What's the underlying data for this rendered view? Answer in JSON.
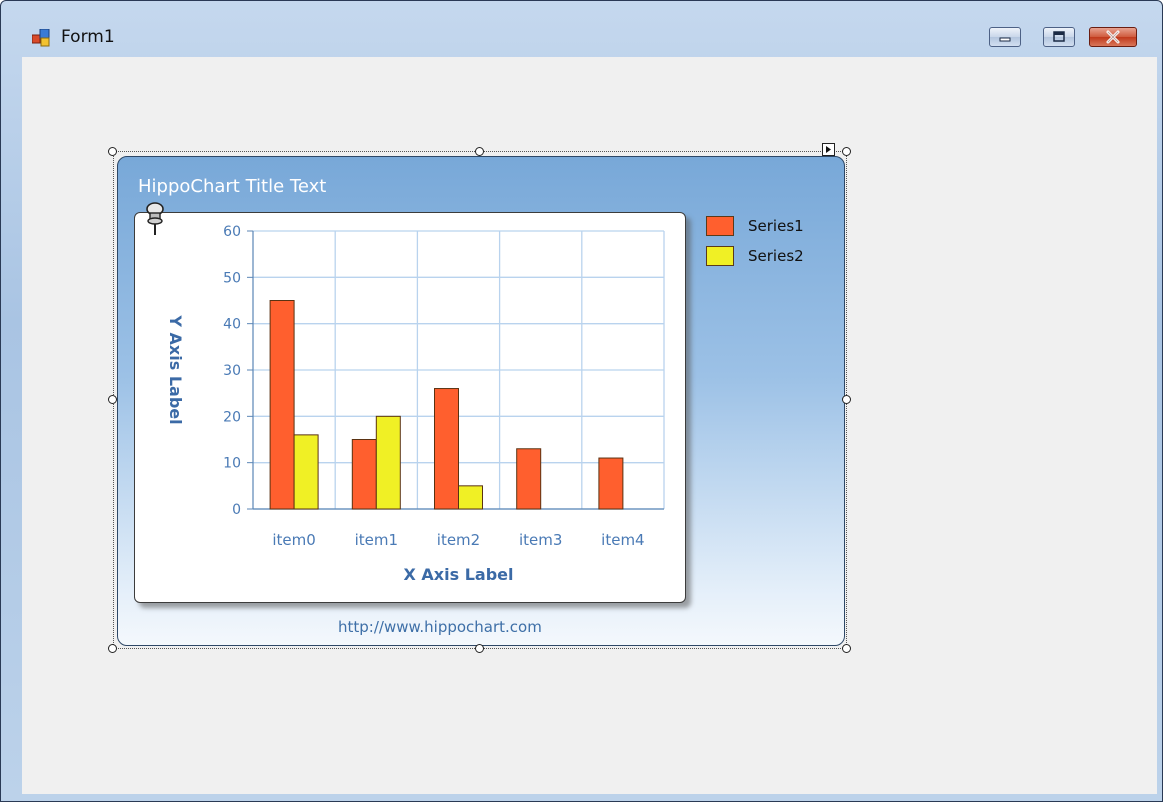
{
  "window": {
    "title": "Form1",
    "icon": "form-icon",
    "controls": [
      "minimize-icon",
      "maximize-icon",
      "close-icon"
    ]
  },
  "chart": {
    "title": "HippoChart Title Text",
    "footer": "http://www.hippochart.com",
    "frame_color": "#78a8d8",
    "pin_icon": "pushpin-icon"
  },
  "chart_data": {
    "type": "bar",
    "categories": [
      "item0",
      "item1",
      "item2",
      "item3",
      "item4"
    ],
    "series": [
      {
        "name": "Series1",
        "values": [
          45,
          15,
          26,
          13,
          11
        ],
        "color": "#ff5f2e"
      },
      {
        "name": "Series2",
        "values": [
          16,
          20,
          5,
          null,
          null
        ],
        "color": "#f0f025"
      }
    ],
    "title": "HippoChart Title Text",
    "xlabel": "X Axis Label",
    "ylabel": "Y Axis Label",
    "ylim": [
      0,
      60
    ],
    "yticks": [
      0,
      10,
      20,
      30,
      40,
      50,
      60
    ],
    "grid": true,
    "legend": "top-right"
  }
}
